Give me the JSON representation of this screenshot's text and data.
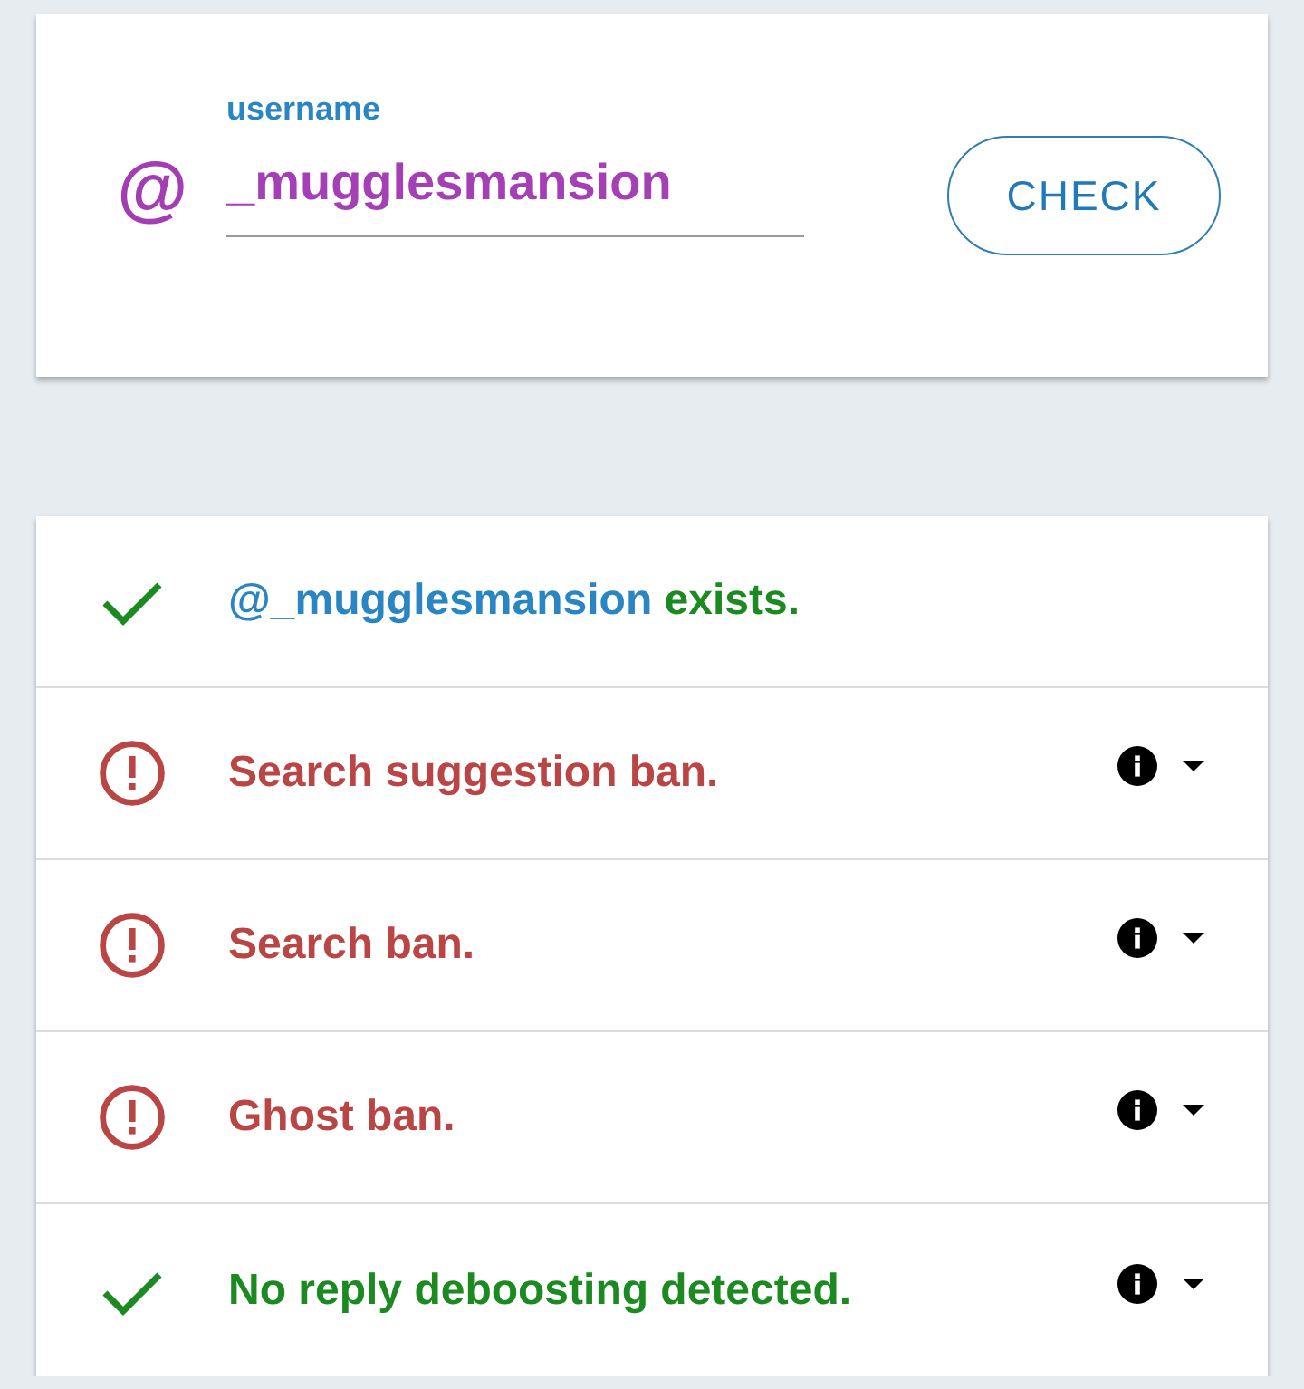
{
  "search": {
    "prefix": "@",
    "label": "username",
    "value": "_mugglesmansion",
    "button": "CHECK"
  },
  "results": {
    "account": {
      "kind": "pass",
      "handle": "@_mugglesmansion",
      "text": "exists."
    },
    "checks": [
      {
        "kind": "ban",
        "text": "Search suggestion ban.",
        "expanded": false
      },
      {
        "kind": "ban",
        "text": "Search ban.",
        "expanded": false
      },
      {
        "kind": "ban",
        "text": "Ghost ban.",
        "expanded": false
      },
      {
        "kind": "pass",
        "text": "No reply deboosting detected.",
        "expanded": false
      }
    ]
  }
}
